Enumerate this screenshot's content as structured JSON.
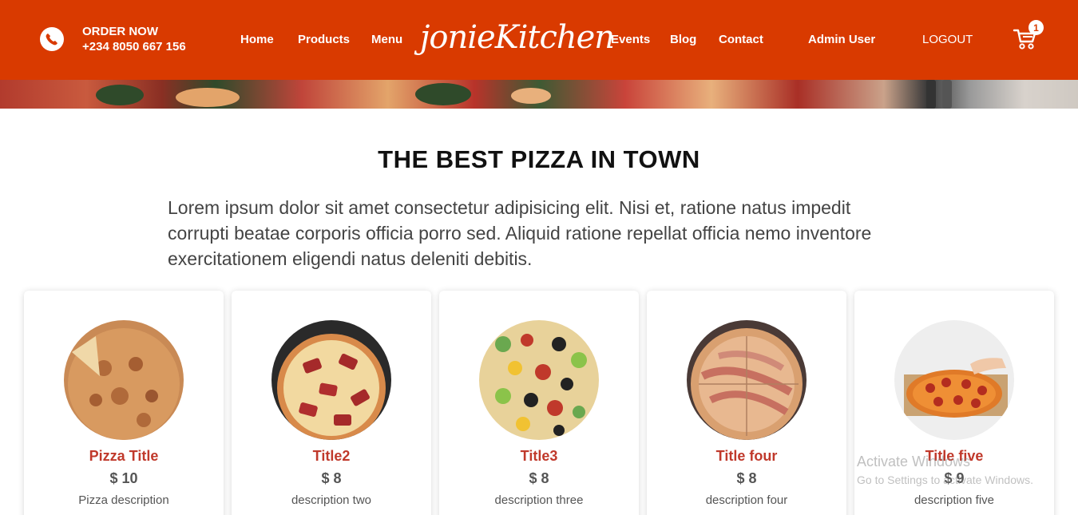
{
  "header": {
    "order_title": "ORDER NOW",
    "order_phone": "+234 8050 667 156",
    "nav_left": [
      "Home",
      "Products",
      "Menu"
    ],
    "brand": "jonieKitchen",
    "nav_right": [
      "Events",
      "Blog",
      "Contact"
    ],
    "user": "Admin User",
    "logout": "LOGOUT",
    "cart_count": "1",
    "icons": {
      "phone": "phone-icon",
      "cart": "cart-icon"
    },
    "colors": {
      "bar": "#d93a00"
    }
  },
  "intro": {
    "title": "THE BEST PIZZA IN TOWN",
    "text": "Lorem ipsum dolor sit amet consectetur adipisicing elit. Nisi et, ratione natus impedit corrupti beatae corporis officia porro sed. Aliquid ratione repellat officia nemo inventore exercitationem eligendi natus deleniti debitis."
  },
  "products": [
    {
      "title": "Pizza Title",
      "price": "$ 10",
      "desc": "Pizza description"
    },
    {
      "title": "Title2",
      "price": "$ 8",
      "desc": "description two"
    },
    {
      "title": "Title3",
      "price": "$ 8",
      "desc": "description three"
    },
    {
      "title": "Title four",
      "price": "$ 8",
      "desc": "description four"
    },
    {
      "title": "Title five",
      "price": "$ 9",
      "desc": "description five"
    }
  ],
  "watermark": {
    "line1": "Activate Windows",
    "line2": "Go to Settings to activate Windows."
  }
}
